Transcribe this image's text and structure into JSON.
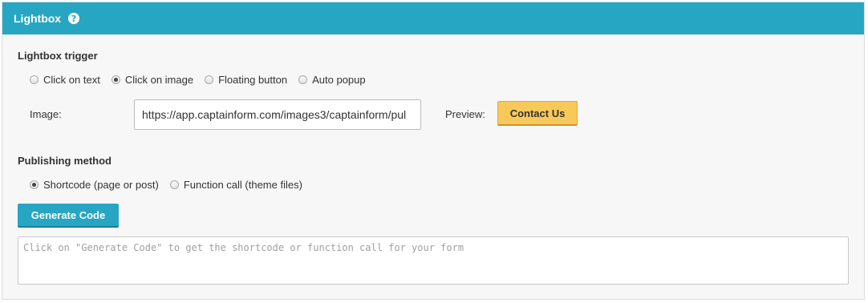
{
  "header": {
    "title": "Lightbox",
    "help_glyph": "?"
  },
  "trigger": {
    "title": "Lightbox trigger",
    "options": [
      {
        "label": "Click on text",
        "checked": false
      },
      {
        "label": "Click on image",
        "checked": true
      },
      {
        "label": "Floating button",
        "checked": false
      },
      {
        "label": "Auto popup",
        "checked": false
      }
    ],
    "image_label": "Image:",
    "image_value": "https://app.captainform.com/images3/captainform/pul",
    "preview_label": "Preview:",
    "preview_button": "Contact Us"
  },
  "publishing": {
    "title": "Publishing method",
    "options": [
      {
        "label": "Shortcode (page or post)",
        "checked": true
      },
      {
        "label": "Function call (theme files)",
        "checked": false
      }
    ],
    "generate_button": "Generate Code",
    "code_placeholder": "Click on \"Generate Code\" to get the shortcode or function call for your form"
  },
  "colors": {
    "accent": "#27a6c3",
    "preview_button": "#f8c95a"
  },
  "icons": {
    "help": "help-icon"
  }
}
